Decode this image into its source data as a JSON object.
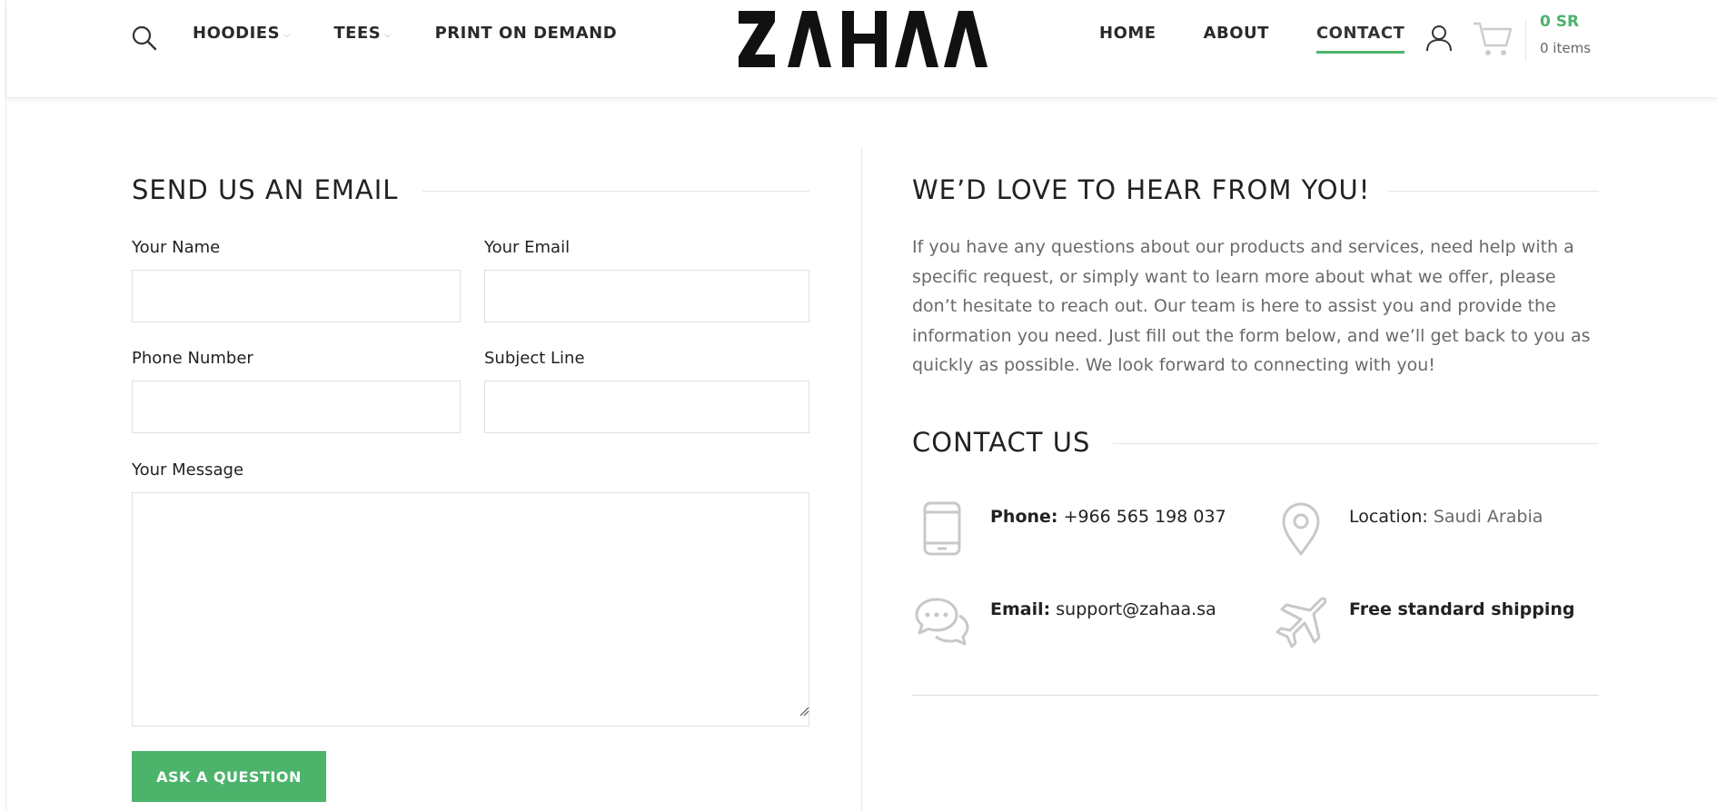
{
  "header": {
    "nav_left": [
      {
        "label": "HOODIES",
        "has_dropdown": true
      },
      {
        "label": "TEES",
        "has_dropdown": true
      },
      {
        "label": "PRINT ON DEMAND",
        "has_dropdown": false
      }
    ],
    "logo_text": "ZAHAA",
    "nav_right": [
      {
        "label": "HOME",
        "active": false
      },
      {
        "label": "ABOUT",
        "active": false
      },
      {
        "label": "CONTACT",
        "active": true
      }
    ],
    "cart_total": "0 SR",
    "cart_count": "0 items"
  },
  "form": {
    "title": "SEND US AN EMAIL",
    "name_label": "Your Name",
    "name_value": "",
    "email_label": "Your Email",
    "email_value": "",
    "phone_label": "Phone Number",
    "phone_value": "",
    "subject_label": "Subject Line",
    "subject_value": "",
    "message_label": "Your Message",
    "message_value": "",
    "submit_label": "ASK A QUESTION"
  },
  "about": {
    "title": "WE’D LOVE TO HEAR FROM YOU!",
    "intro": "If you have any questions about our products and services, need help with a specific request, or simply want to learn more about what we offer, please don’t hesitate to reach out. Our team is here to assist you and provide the information you need. Just fill out the form below, and we’ll get back to you as quickly as possible. We look forward to connecting with you!"
  },
  "contact": {
    "title": "CONTACT US",
    "phone_label": "Phone:",
    "phone_value": "+966 565 198 037",
    "location_label": "Location:",
    "location_value": "Saudi Arabia",
    "email_label": "Email:",
    "email_value": "support@zahaa.sa",
    "shipping_text": "Free standard shipping"
  },
  "colors": {
    "accent": "#4cb36b",
    "text": "#222222",
    "muted": "#6a6a6a",
    "icon_gray": "#c8c8c8"
  },
  "icons": [
    "search-icon",
    "user-icon",
    "cart-icon",
    "phone-icon",
    "location-pin-icon",
    "chat-bubbles-icon",
    "airplane-icon"
  ]
}
